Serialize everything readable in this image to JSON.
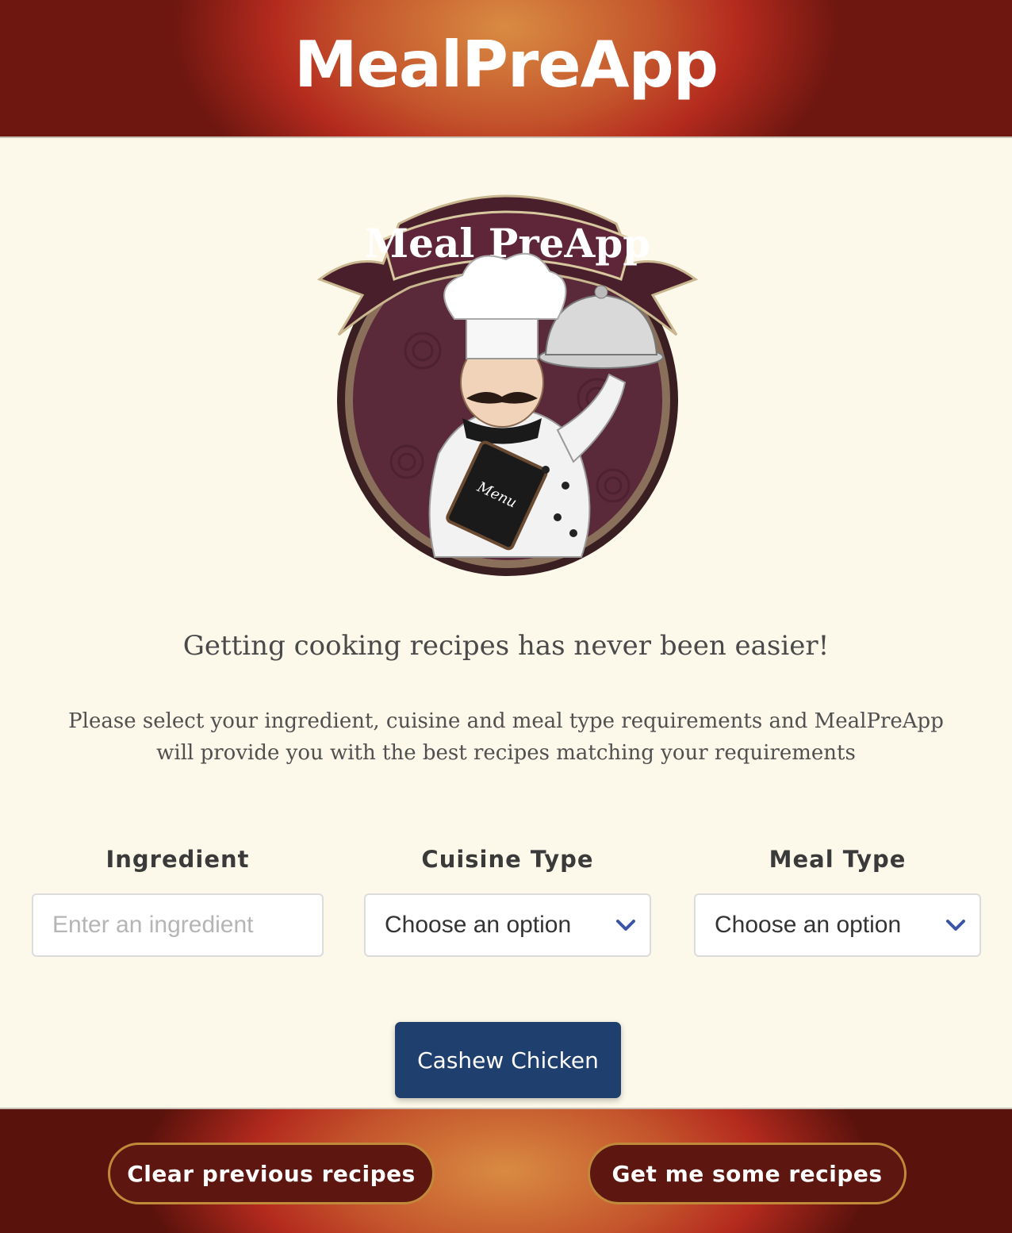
{
  "header": {
    "title": "MealPreApp"
  },
  "logo": {
    "banner_text": "Meal PreApp",
    "menu_text": "Menu"
  },
  "content": {
    "tagline": "Getting cooking recipes has never been easier!",
    "intro": "Please select your ingredient, cuisine and meal type requirements and MealPreApp will provide you with the best recipes matching your requirements"
  },
  "form": {
    "ingredient": {
      "label": "Ingredient",
      "placeholder": "Enter an ingredient",
      "value": ""
    },
    "cuisine": {
      "label": "Cuisine Type",
      "selected": "Choose an option"
    },
    "meal": {
      "label": "Meal Type",
      "selected": "Choose an option"
    }
  },
  "recipe_button": {
    "label": "Cashew Chicken"
  },
  "footer": {
    "clear_label": "Clear previous recipes",
    "get_label": "Get me some recipes"
  },
  "colors": {
    "header_red": "#b42a1e",
    "accent_orange": "#d98b42",
    "recipe_blue": "#1f3f6e",
    "button_maroon": "#5e1710",
    "chevron_blue": "#3a55a8"
  }
}
